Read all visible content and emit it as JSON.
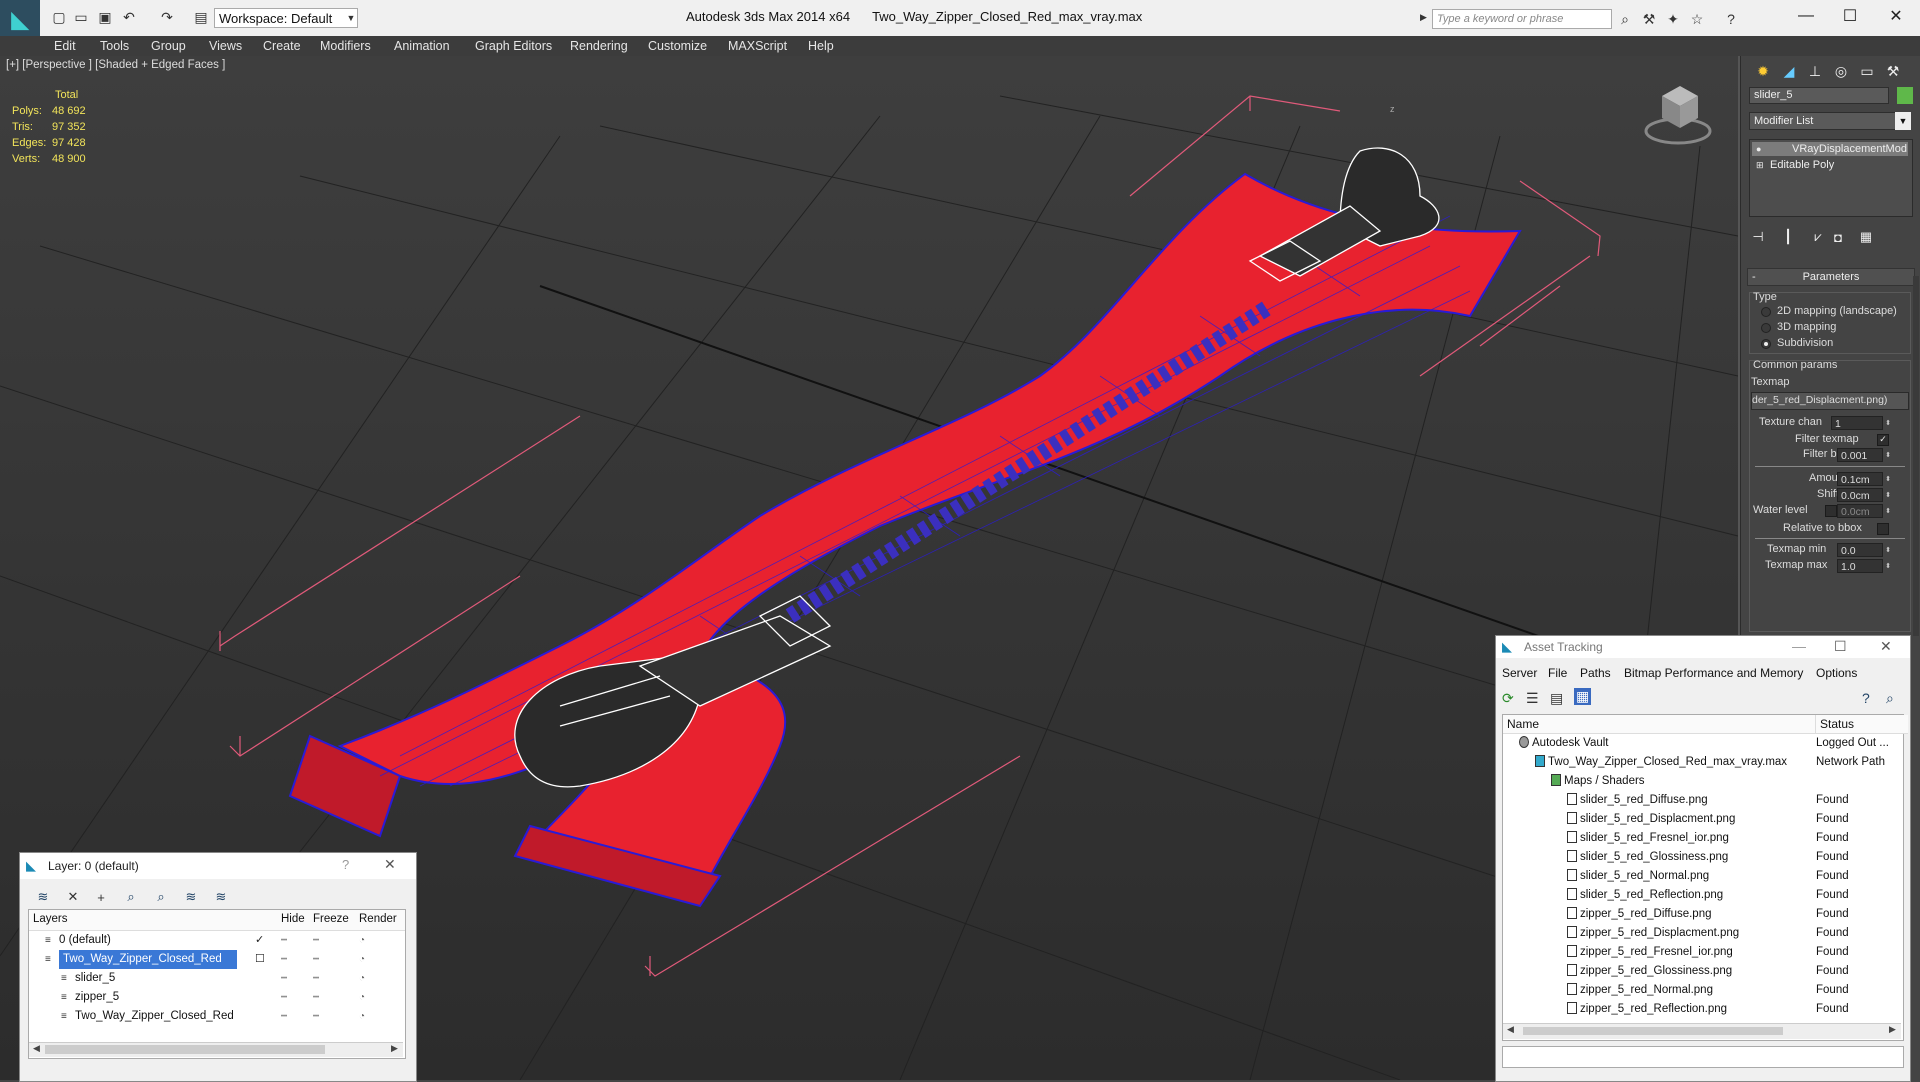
{
  "app": {
    "title": "Autodesk 3ds Max  2014 x64",
    "file": "Two_Way_Zipper_Closed_Red_max_vray.max",
    "workspace": "Workspace: Default",
    "search_placeholder": "Type a keyword or phrase"
  },
  "menu": [
    "Edit",
    "Tools",
    "Group",
    "Views",
    "Create",
    "Modifiers",
    "Animation",
    "Graph Editors",
    "Rendering",
    "Customize",
    "MAXScript",
    "Help"
  ],
  "viewport": {
    "label": "[+] [Perspective ] [Shaded + Edged Faces ]",
    "stats": {
      "header": "Total",
      "rows": [
        {
          "k": "Polys:",
          "v": "48 692"
        },
        {
          "k": "Tris:",
          "v": "97 352"
        },
        {
          "k": "Edges:",
          "v": "97 428"
        },
        {
          "k": "Verts:",
          "v": "48 900"
        }
      ]
    },
    "axis_label": "z"
  },
  "command_panel": {
    "object_name": "slider_5",
    "object_color": "#5fb84a",
    "modifier_list": "Modifier List",
    "stack": [
      "VRayDisplacementMod",
      "Editable Poly"
    ],
    "params_title": "Parameters",
    "type_label": "Type",
    "type_options": [
      {
        "label": "2D mapping (landscape)",
        "selected": false
      },
      {
        "label": "3D mapping",
        "selected": false
      },
      {
        "label": "Subdivision",
        "selected": true
      }
    ],
    "common_label": "Common params",
    "texmap_label": "Texmap",
    "texmap_value": "der_5_red_Displacment.png)",
    "texture_chan_label": "Texture chan",
    "texture_chan_value": "1",
    "filter_texmap_label": "Filter texmap",
    "filter_blur_label": "Filter blur",
    "filter_blur_value": "0.001",
    "amount_label": "Amount",
    "amount_value": "0.1cm",
    "shift_label": "Shift",
    "shift_value": "0.0cm",
    "water_label": "Water level",
    "water_value": "0.0cm",
    "relative_label": "Relative to bbox",
    "texmap_min_label": "Texmap min",
    "texmap_min_value": "0.0",
    "texmap_max_label": "Texmap max",
    "texmap_max_value": "1.0"
  },
  "asset_tracking": {
    "title": "Asset Tracking",
    "menu": [
      "Server",
      "File",
      "Paths",
      "Bitmap Performance and Memory",
      "Options"
    ],
    "col_name": "Name",
    "col_status": "Status",
    "rows": [
      {
        "name": "Autodesk Vault",
        "status": "Logged Out ...",
        "indent": 1,
        "kind": "vault"
      },
      {
        "name": "Two_Way_Zipper_Closed_Red_max_vray.max",
        "status": "Network Path",
        "indent": 2,
        "kind": "max"
      },
      {
        "name": "Maps / Shaders",
        "status": "",
        "indent": 3,
        "kind": "folder"
      },
      {
        "name": "slider_5_red_Diffuse.png",
        "status": "Found",
        "indent": 4,
        "kind": "file"
      },
      {
        "name": "slider_5_red_Displacment.png",
        "status": "Found",
        "indent": 4,
        "kind": "file"
      },
      {
        "name": "slider_5_red_Fresnel_ior.png",
        "status": "Found",
        "indent": 4,
        "kind": "file"
      },
      {
        "name": "slider_5_red_Glossiness.png",
        "status": "Found",
        "indent": 4,
        "kind": "file"
      },
      {
        "name": "slider_5_red_Normal.png",
        "status": "Found",
        "indent": 4,
        "kind": "file"
      },
      {
        "name": "slider_5_red_Reflection.png",
        "status": "Found",
        "indent": 4,
        "kind": "file"
      },
      {
        "name": "zipper_5_red_Diffuse.png",
        "status": "Found",
        "indent": 4,
        "kind": "file"
      },
      {
        "name": "zipper_5_red_Displacment.png",
        "status": "Found",
        "indent": 4,
        "kind": "file"
      },
      {
        "name": "zipper_5_red_Fresnel_ior.png",
        "status": "Found",
        "indent": 4,
        "kind": "file"
      },
      {
        "name": "zipper_5_red_Glossiness.png",
        "status": "Found",
        "indent": 4,
        "kind": "file"
      },
      {
        "name": "zipper_5_red_Normal.png",
        "status": "Found",
        "indent": 4,
        "kind": "file"
      },
      {
        "name": "zipper_5_red_Reflection.png",
        "status": "Found",
        "indent": 4,
        "kind": "file"
      }
    ]
  },
  "layer_dialog": {
    "title": "Layer: 0 (default)",
    "help": "?",
    "col_layers": "Layers",
    "col_hide": "Hide",
    "col_freeze": "Freeze",
    "col_render": "Render",
    "rows": [
      {
        "name": "0 (default)",
        "indent": 1,
        "selected": false,
        "check": true
      },
      {
        "name": "Two_Way_Zipper_Closed_Red",
        "indent": 1,
        "selected": true,
        "check": false
      },
      {
        "name": "slider_5",
        "indent": 2,
        "selected": false,
        "check": false
      },
      {
        "name": "zipper_5",
        "indent": 2,
        "selected": false,
        "check": false
      },
      {
        "name": "Two_Way_Zipper_Closed_Red",
        "indent": 2,
        "selected": false,
        "check": false
      }
    ]
  },
  "colors": {
    "mesh_fill": "#e8222f",
    "mesh_wire": "#2a1bd6",
    "bbox": "#e05a7a",
    "slider": "#ffffff"
  }
}
